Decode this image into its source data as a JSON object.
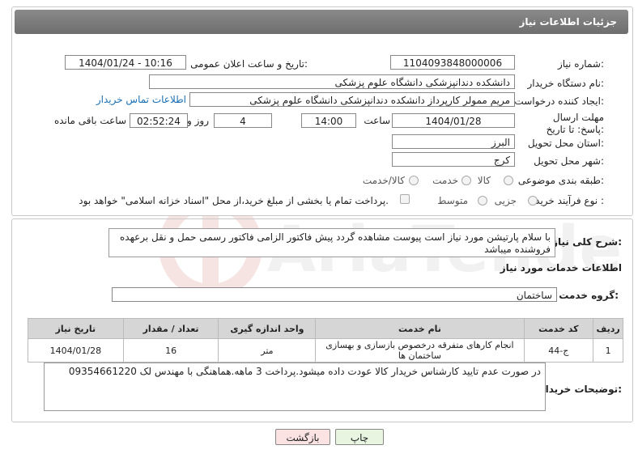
{
  "header": {
    "title": "جزئیات اطلاعات نیاز"
  },
  "fields": {
    "need_number_label": "شماره نیاز:",
    "need_number": "1104093848000006",
    "announce_label": "تاریخ و ساعت اعلان عمومی:",
    "announce_value": "1404/01/24 - 10:16",
    "buyer_label": "نام دستگاه خریدار:",
    "buyer_value": "دانشکده دندانپزشکی دانشگاه علوم پزشکی",
    "creator_label": "ایجاد کننده درخواست:",
    "creator_value": "مریم ممولر کارپرداز دانشکده دندانپزشکی دانشگاه علوم پزشکی",
    "contact_link": "اطلاعات تماس خریدار",
    "deadline_label": "مهلت ارسال پاسخ: تا تاریخ:",
    "deadline_date": "1404/01/28",
    "time_label": "ساعت",
    "deadline_time": "14:00",
    "days_value": "4",
    "days_label": "روز و",
    "remaining_time": "02:52:24",
    "remaining_label": "ساعت باقی مانده",
    "province_label": "استان محل تحویل:",
    "province_value": "البرز",
    "city_label": "شهر محل تحویل:",
    "city_value": "کرج",
    "category_label": "طبقه بندی موضوعی:",
    "category_options": [
      "کالا",
      "خدمت",
      "کالا/خدمت"
    ],
    "process_label": "نوع فرآیند خرید :",
    "process_options": [
      "جزیی",
      "متوسط"
    ],
    "payment_note": "پرداخت تمام یا بخشی از مبلغ خرید،از محل \"اسناد خزانه اسلامی\" خواهد بود."
  },
  "description": {
    "label": "شرح کلی نیاز:",
    "text": "با سلام پارتیشن مورد نیاز است پیوست مشاهده گردد پیش فاکتور الزامی فاکتور رسمی حمل و نقل برعهده فروشنده میباشد"
  },
  "services": {
    "section_title": "اطلاعات خدمات مورد نیاز",
    "group_label": "گروه خدمت:",
    "group_value": "ساختمان",
    "columns": [
      "ردیف",
      "کد خدمت",
      "نام خدمت",
      "واحد اندازه گیری",
      "تعداد / مقدار",
      "تاریخ نیاز"
    ],
    "rows": [
      [
        "1",
        "ج-44",
        "انجام کارهای متفرقه درخصوص بازسازی و بهسازی ساختمان ها",
        "متر",
        "16",
        "1404/01/28"
      ]
    ]
  },
  "buyer_notes": {
    "label": "توضیحات خریدار:",
    "text": "در صورت عدم تایید کارشناس خریدار کالا عودت داده میشود.پرداخت 3 ماهه.هماهنگی با مهندس لک 09354661220"
  },
  "buttons": {
    "print": "چاپ",
    "back": "بازگشت"
  },
  "watermark": {
    "text": "AriaTender.neT"
  },
  "colors": {
    "header_bg": "#7a7a7a",
    "link": "#1a6fb5",
    "print_btn": "#e8f5e0",
    "back_btn": "#fbe3e3"
  }
}
